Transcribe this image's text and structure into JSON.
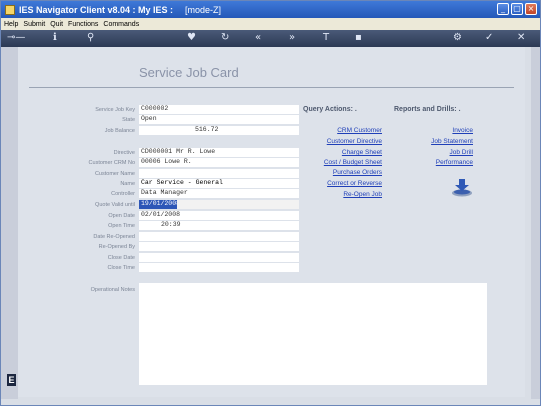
{
  "window": {
    "title": "IES Navigator Client v8.04 : My IES :",
    "mode": "[mode-Z]"
  },
  "menu": [
    "Help",
    "Submit",
    "Quit",
    "Functions",
    "Commands"
  ],
  "page": {
    "title": "Service Job Card"
  },
  "fields": [
    {
      "label": "Service Job Key",
      "value": "C000002"
    },
    {
      "label": "State",
      "value": "Open"
    },
    {
      "label": "Job Balance",
      "value": "516.72"
    },
    {
      "label": "Directive",
      "value": "CD000001 Mr R. Lowe"
    },
    {
      "label": "Customer CRM No",
      "value": "00006 Lowe R."
    },
    {
      "label": "Customer Name",
      "value": ""
    },
    {
      "label": "Name",
      "value": "Car Service - General"
    },
    {
      "label": "Controller",
      "value": "Data Manager"
    },
    {
      "label": "Quote Valid until",
      "value": "19/01/2008"
    },
    {
      "label": "Open Date",
      "value": "02/01/2008"
    },
    {
      "label": "Open Time",
      "value": "20:39"
    },
    {
      "label": "Date Re-Opened",
      "value": ""
    },
    {
      "label": "Re-Opened By",
      "value": ""
    },
    {
      "label": "Close Date",
      "value": ""
    },
    {
      "label": "Close Time",
      "value": ""
    }
  ],
  "notes": {
    "label": "Operational Notes",
    "value": ""
  },
  "query_actions": {
    "heading": "Query Actions: .",
    "links": [
      "CRM Customer",
      "Customer Directive",
      "Charge Sheet",
      "Cost / Budget Sheet",
      "Purchase Orders",
      "Correct or Reverse",
      "Re-Open Job"
    ]
  },
  "reports": {
    "heading": "Reports and Drills: .",
    "links": [
      "Invoice",
      "Job Statement",
      "Job Drill",
      "Performance"
    ]
  },
  "icons": {
    "app": "app-icon",
    "download": "download-icon",
    "badge": "E"
  },
  "colors": {
    "titlebar": "#2d62c8",
    "toolbar": "#3a4866",
    "link": "#1f3fb8",
    "selection": "#2d56b7"
  }
}
